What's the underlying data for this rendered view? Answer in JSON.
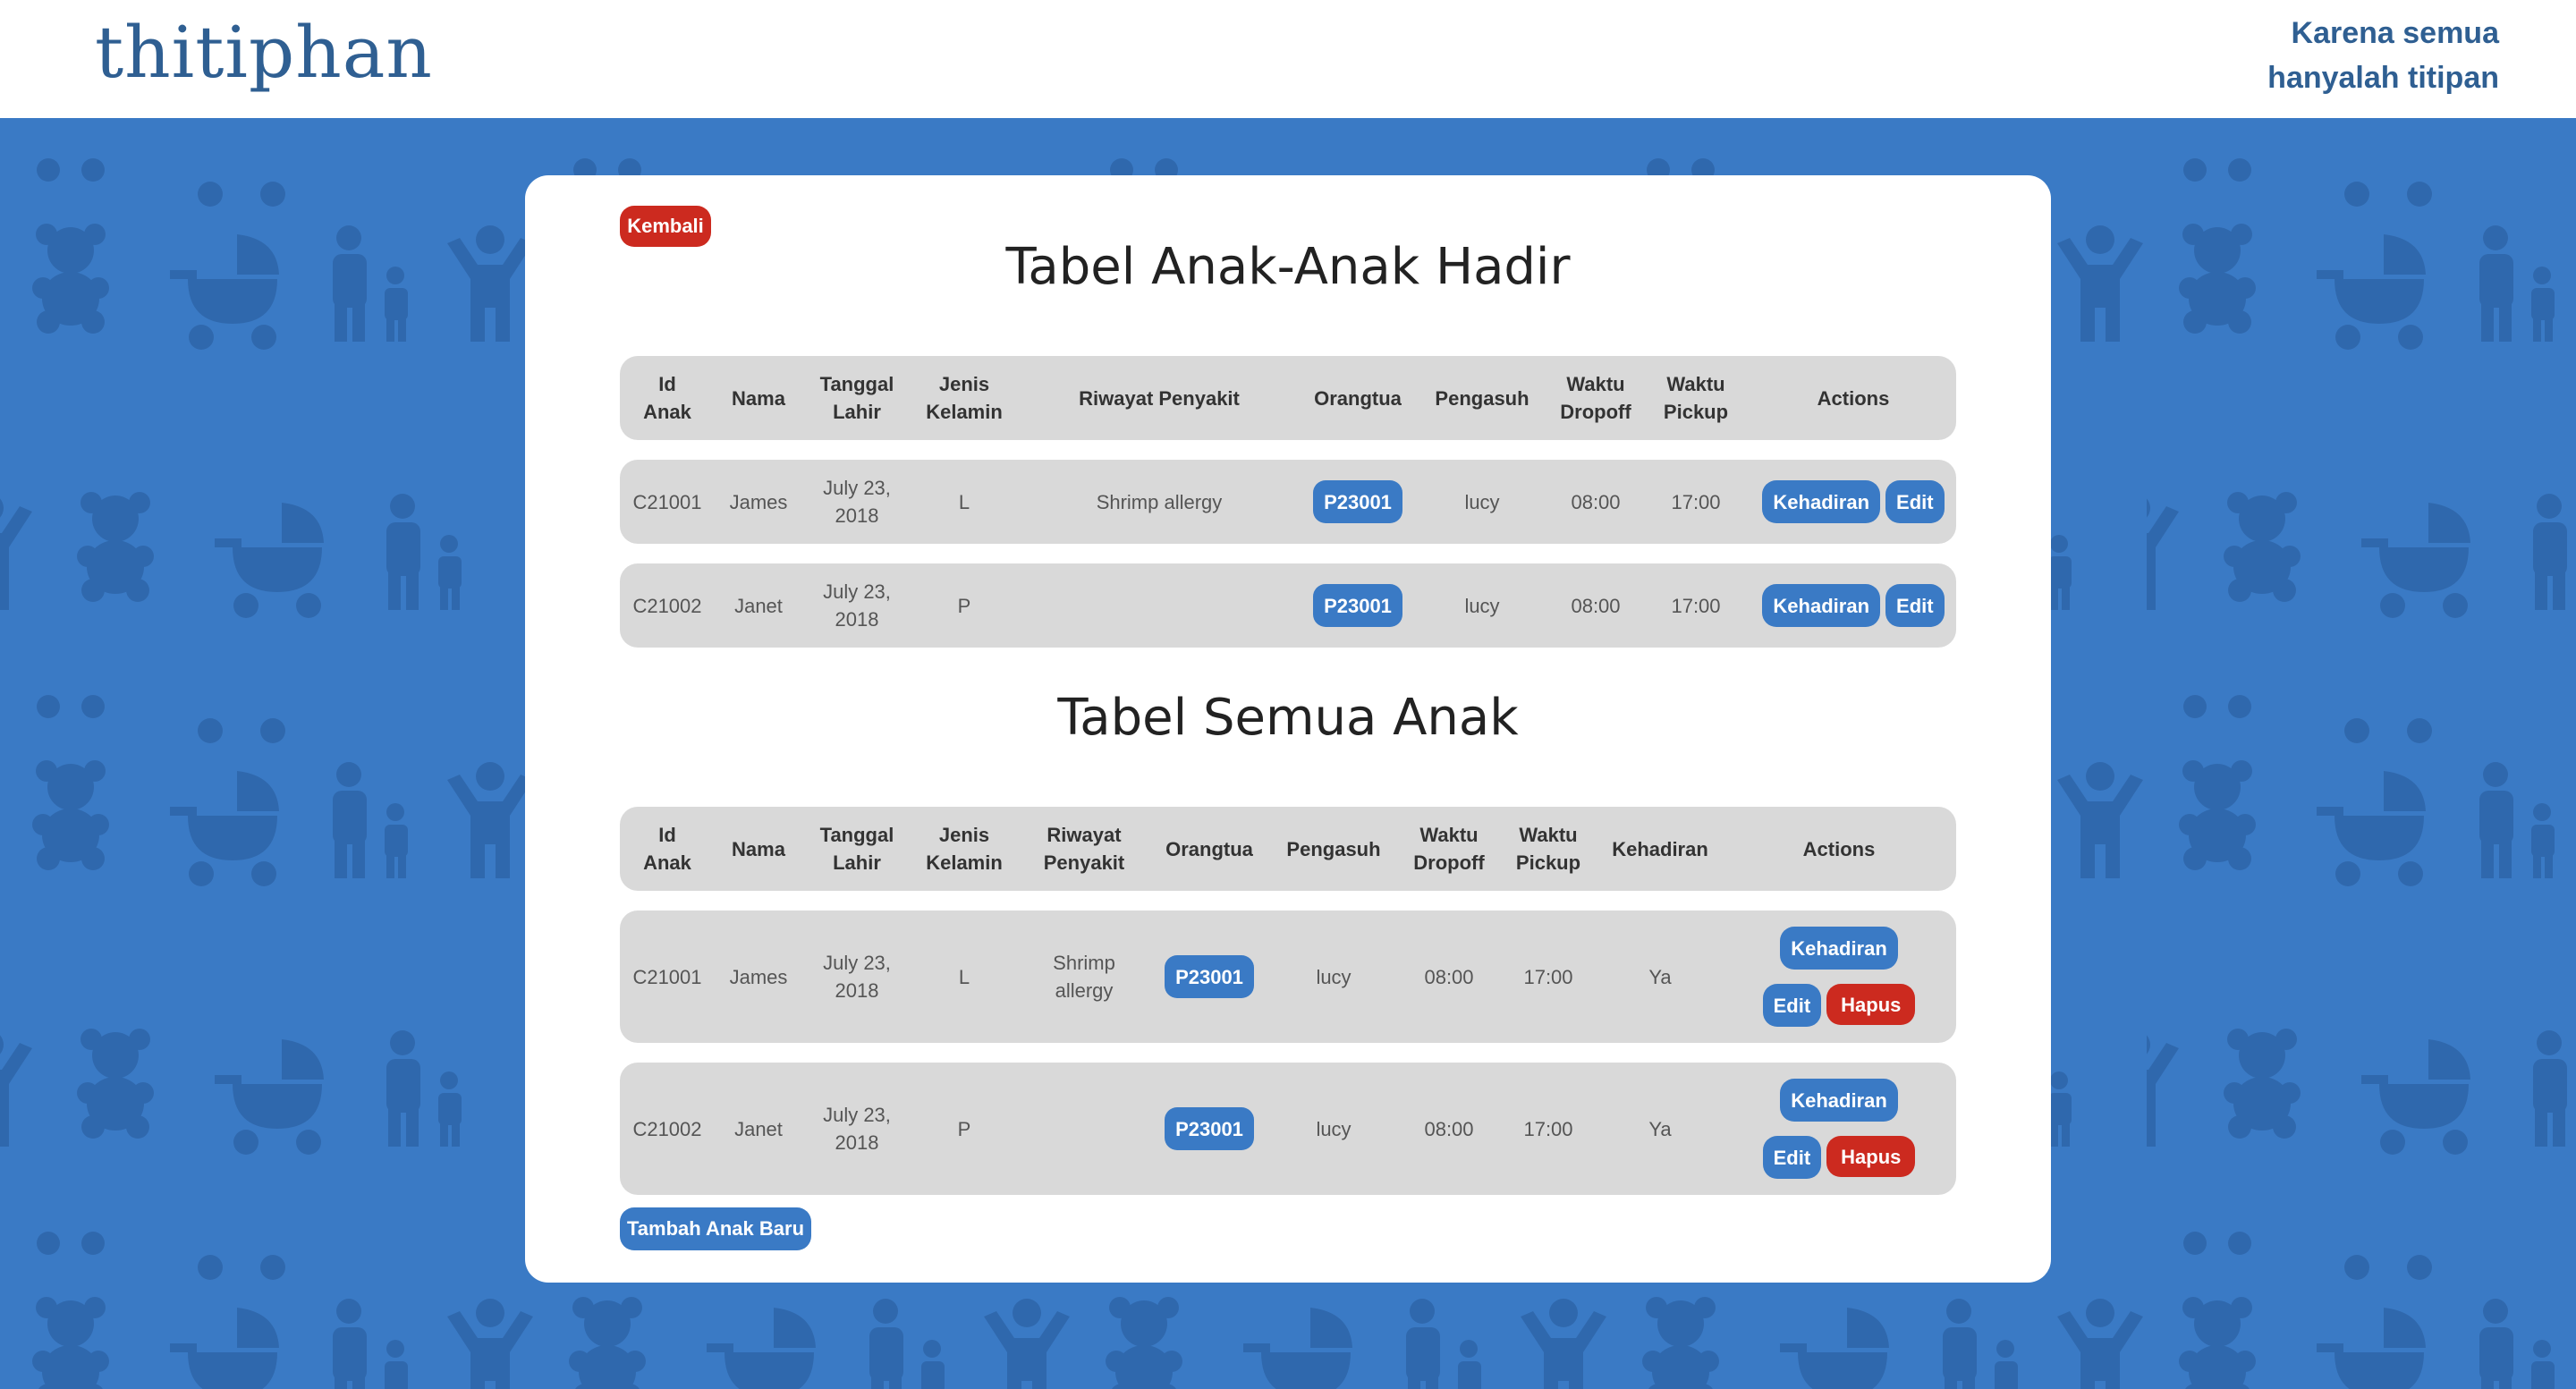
{
  "header": {
    "logo": "thitiphan",
    "tagline_line1": "Karena semua",
    "tagline_line2": "hanyalah titipan"
  },
  "theme": {
    "accent": "#3a7ac5",
    "danger": "#cc2a1f",
    "row_bg": "#d9d9d9"
  },
  "back_label": "Kembali",
  "present_table": {
    "title": "Tabel Anak-Anak Hadir",
    "headers": {
      "id": [
        "Id",
        "Anak"
      ],
      "name": "Nama",
      "dob": [
        "Tanggal",
        "Lahir"
      ],
      "gender": [
        "Jenis",
        "Kelamin"
      ],
      "history": "Riwayat Penyakit",
      "parent": "Orangtua",
      "caregiver": "Pengasuh",
      "dropoff": [
        "Waktu",
        "Dropoff"
      ],
      "pickup": [
        "Waktu",
        "Pickup"
      ],
      "actions": "Actions"
    },
    "rows": [
      {
        "id": "C21001",
        "name": "James",
        "dob": [
          "July 23,",
          "2018"
        ],
        "gender": "L",
        "history": "Shrimp allergy",
        "parent": "P23001",
        "caregiver": "lucy",
        "dropoff": "08:00",
        "pickup": "17:00",
        "btn_attendance": "Kehadiran",
        "btn_edit": "Edit"
      },
      {
        "id": "C21002",
        "name": "Janet",
        "dob": [
          "July 23,",
          "2018"
        ],
        "gender": "P",
        "history": "",
        "parent": "P23001",
        "caregiver": "lucy",
        "dropoff": "08:00",
        "pickup": "17:00",
        "btn_attendance": "Kehadiran",
        "btn_edit": "Edit"
      }
    ]
  },
  "all_table": {
    "title": "Tabel Semua Anak",
    "headers": {
      "id": [
        "Id",
        "Anak"
      ],
      "name": "Nama",
      "dob": [
        "Tanggal",
        "Lahir"
      ],
      "gender": [
        "Jenis",
        "Kelamin"
      ],
      "history": [
        "Riwayat",
        "Penyakit"
      ],
      "parent": "Orangtua",
      "caregiver": "Pengasuh",
      "dropoff": [
        "Waktu",
        "Dropoff"
      ],
      "pickup": [
        "Waktu",
        "Pickup"
      ],
      "attendance": "Kehadiran",
      "actions": "Actions"
    },
    "rows": [
      {
        "id": "C21001",
        "name": "James",
        "dob": [
          "July 23,",
          "2018"
        ],
        "gender": "L",
        "history": [
          "Shrimp",
          "allergy"
        ],
        "parent": "P23001",
        "caregiver": "lucy",
        "dropoff": "08:00",
        "pickup": "17:00",
        "attendance": "Ya",
        "btn_attendance": "Kehadiran",
        "btn_edit": "Edit",
        "btn_delete": "Hapus"
      },
      {
        "id": "C21002",
        "name": "Janet",
        "dob": [
          "July 23,",
          "2018"
        ],
        "gender": "P",
        "history": [
          "",
          ""
        ],
        "parent": "P23001",
        "caregiver": "lucy",
        "dropoff": "08:00",
        "pickup": "17:00",
        "attendance": "Ya",
        "btn_attendance": "Kehadiran",
        "btn_edit": "Edit",
        "btn_delete": "Hapus"
      }
    ]
  },
  "add_child_label": "Tambah Anak Baru"
}
